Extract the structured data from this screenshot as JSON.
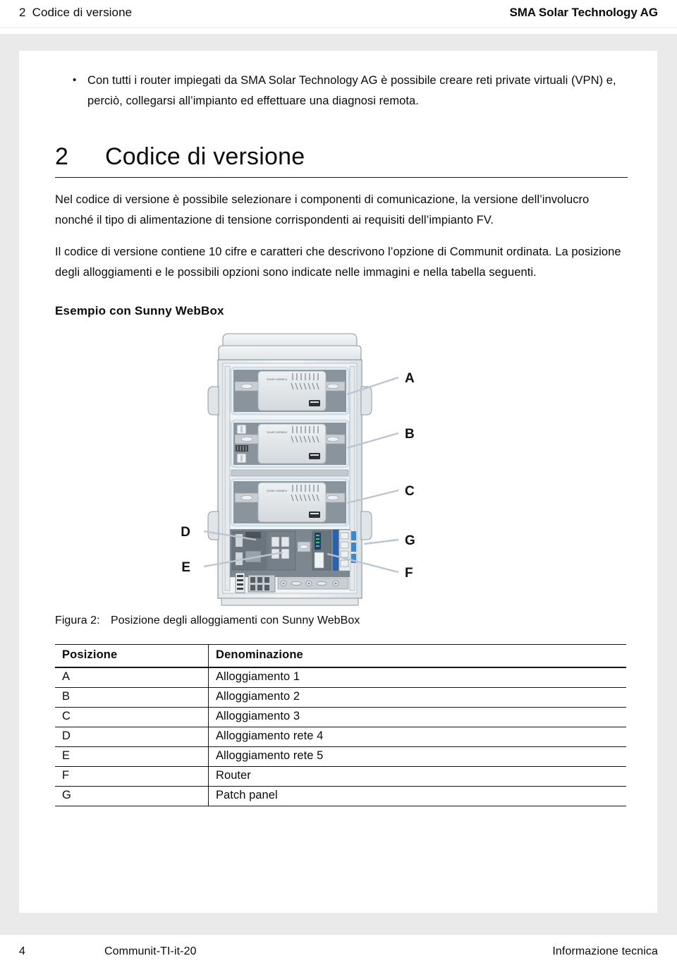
{
  "header": {
    "chapter_number": "2",
    "chapter_title": "Codice di versione",
    "company": "SMA Solar Technology AG"
  },
  "bullets": [
    "Con tutti i router impiegati da SMA Solar Technology AG è possibile creare reti private virtuali (VPN) e, perciò, collegarsi all’impianto ed effettuare una diagnosi remota."
  ],
  "chapter": {
    "number": "2",
    "title": "Codice di versione"
  },
  "paragraphs": [
    "Nel codice di versione è possibile selezionare i componenti di comunicazione, la versione dell’involucro nonché il tipo di alimentazione di tensione corrispondenti ai requisiti dell’impianto FV.",
    "Il codice di versione contiene 10 cifre e caratteri che descrivono l’opzione di Communit ordinata. La posizione degli alloggiamenti e le possibili opzioni sono indicate nelle immagini e nella tabella seguenti."
  ],
  "subheading": "Esempio con Sunny WebBox",
  "figure": {
    "caption_label": "Figura 2:",
    "caption_text": "Posizione degli alloggiamenti con Sunny WebBox",
    "device_label": "SUNNY WEBBOX",
    "callouts": [
      {
        "letter": "A",
        "side": "right"
      },
      {
        "letter": "B",
        "side": "right"
      },
      {
        "letter": "C",
        "side": "right"
      },
      {
        "letter": "D",
        "side": "left"
      },
      {
        "letter": "E",
        "side": "left"
      },
      {
        "letter": "F",
        "side": "right"
      },
      {
        "letter": "G",
        "side": "right"
      }
    ],
    "colors": {
      "cabinet_body": "#e8eaec",
      "cabinet_outline": "#8f9aa3",
      "interior_dark": "#7c8790",
      "device_face": "#dfe3e6",
      "accent_blue": "#2a62b0",
      "port_blue": "#3f86c8",
      "callout_line": "#b9c6d2"
    }
  },
  "table": {
    "columns": [
      "Posizione",
      "Denominazione"
    ],
    "rows": [
      [
        "A",
        "Alloggiamento 1"
      ],
      [
        "B",
        "Alloggiamento 2"
      ],
      [
        "C",
        "Alloggiamento 3"
      ],
      [
        "D",
        "Alloggiamento rete 4"
      ],
      [
        "E",
        "Alloggiamento rete 5"
      ],
      [
        "F",
        "Router"
      ],
      [
        "G",
        "Patch panel"
      ]
    ]
  },
  "footer": {
    "page_number": "4",
    "document_id": "Communit-TI-it-20",
    "document_type": "Informazione tecnica"
  }
}
